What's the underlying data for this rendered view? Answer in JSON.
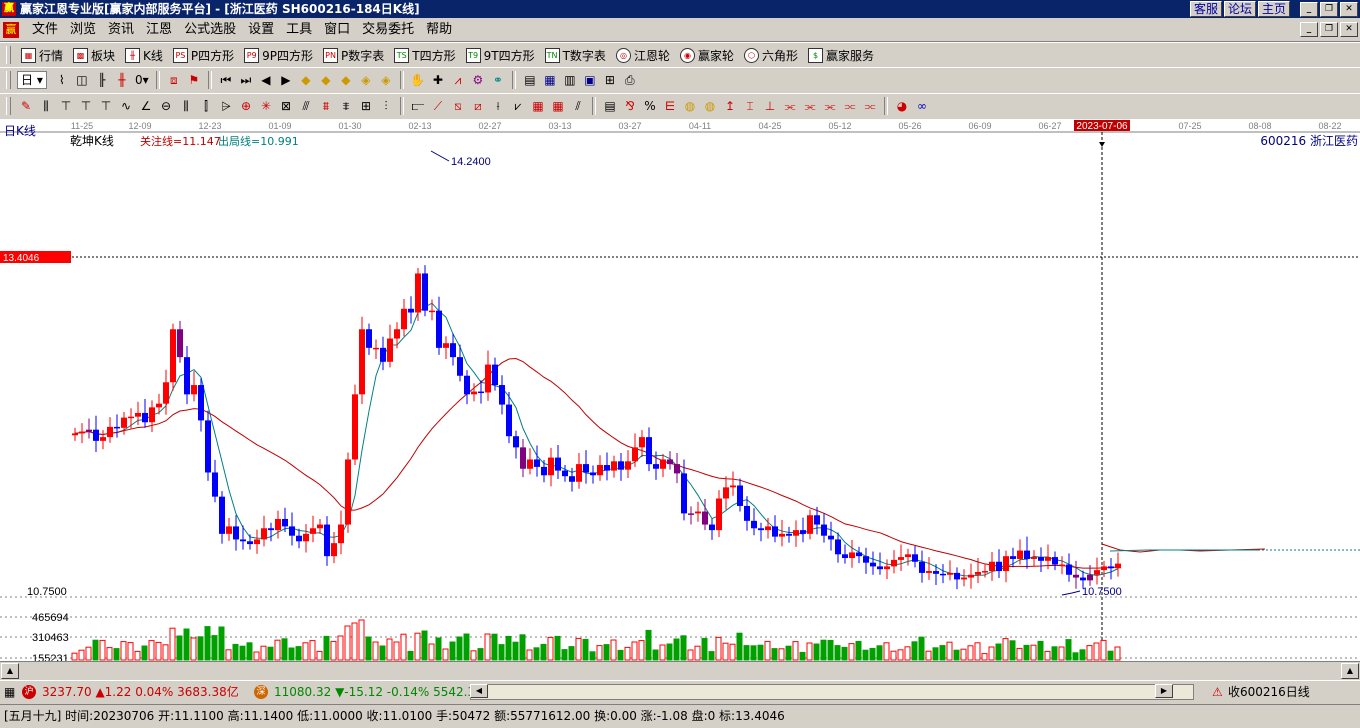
{
  "window": {
    "title": "赢家江恩专业版[赢家内部服务平台] - [浙江医药  SH600216-184日K线]",
    "links": [
      "客服",
      "论坛",
      "主页"
    ]
  },
  "menu": [
    "文件",
    "浏览",
    "资讯",
    "江恩",
    "公式选股",
    "设置",
    "工具",
    "窗口",
    "交易委托",
    "帮助"
  ],
  "toolbar1": [
    "行情",
    "板块",
    "K线",
    "P四方形",
    "9P四方形",
    "P数字表",
    "T四方形",
    "9T四方形",
    "T数字表",
    "江恩轮",
    "赢家轮",
    "六角形",
    "赢家服务"
  ],
  "toolbar2": {
    "period": "日"
  },
  "chart": {
    "period_label": "日K线",
    "indicator_name": "乾坤K线",
    "watch_line": "关注线=11.147",
    "exit_line": "出局线=10.991",
    "stock_label": "600216  浙江医药",
    "cursor_date": "2023-07-06",
    "cursor_price_label": "13.4046",
    "high_label": "14.2400",
    "low_label": "10.7500",
    "axis_low": "10.7500",
    "vol_ticks": [
      "465694",
      "310463",
      "155231"
    ],
    "x_ticks": [
      {
        "label": "11-25",
        "x": 82
      },
      {
        "label": "12-09",
        "x": 140
      },
      {
        "label": "12-23",
        "x": 210
      },
      {
        "label": "01-09",
        "x": 280
      },
      {
        "label": "01-30",
        "x": 350
      },
      {
        "label": "02-13",
        "x": 420
      },
      {
        "label": "02-27",
        "x": 490
      },
      {
        "label": "03-13",
        "x": 560
      },
      {
        "label": "03-27",
        "x": 630
      },
      {
        "label": "04-11",
        "x": 700
      },
      {
        "label": "04-25",
        "x": 770
      },
      {
        "label": "05-12",
        "x": 840
      },
      {
        "label": "05-26",
        "x": 910
      },
      {
        "label": "06-09",
        "x": 980
      },
      {
        "label": "06-27",
        "x": 1050
      },
      {
        "label": "07-25",
        "x": 1190
      },
      {
        "label": "08-08",
        "x": 1260
      },
      {
        "label": "08-22",
        "x": 1330
      }
    ],
    "colors": {
      "up": "#ff0000",
      "down": "#0000ff",
      "special": "#800080",
      "ma_short": "#008080",
      "ma_long": "#c00000"
    }
  },
  "chart_data": {
    "type": "candlestick",
    "closes": [
      12.38,
      12.4,
      12.42,
      12.3,
      12.34,
      12.45,
      12.44,
      12.55,
      12.56,
      12.6,
      12.5,
      12.66,
      12.7,
      12.93,
      13.5,
      13.2,
      12.8,
      12.9,
      12.52,
      11.96,
      11.7,
      11.3,
      11.38,
      11.24,
      11.22,
      11.19,
      11.24,
      11.36,
      11.34,
      11.46,
      11.38,
      11.28,
      11.22,
      11.3,
      11.36,
      11.4,
      11.06,
      11.2,
      11.4,
      12.1,
      12.8,
      13.5,
      13.3,
      13.3,
      13.15,
      13.4,
      13.5,
      13.72,
      13.68,
      14.1,
      13.7,
      13.7,
      13.3,
      13.35,
      13.2,
      13.0,
      12.8,
      12.83,
      12.82,
      13.12,
      12.9,
      12.69,
      12.35,
      12.23,
      12.0,
      12.1,
      12.02,
      11.93,
      12.12,
      11.98,
      11.92,
      11.86,
      12.05,
      11.96,
      11.93,
      12.04,
      11.98,
      12.08,
      11.99,
      12.08,
      12.23,
      12.34,
      12.05,
      12.0,
      12.1,
      12.05,
      11.95,
      11.52,
      11.52,
      11.54,
      11.4,
      11.34,
      11.68,
      11.8,
      11.82,
      11.6,
      11.44,
      11.36,
      11.34,
      11.38,
      11.27,
      11.3,
      11.28,
      11.34,
      11.3,
      11.5,
      11.4,
      11.28,
      11.24,
      11.08,
      11.04,
      11.1,
      11.06,
      10.99,
      10.95,
      10.92,
      10.95,
      11.02,
      11.05,
      11.08,
      11.0,
      10.88,
      10.9,
      10.87,
      10.86,
      10.88,
      10.81,
      10.83,
      10.86,
      10.89,
      10.9,
      11.0,
      10.9,
      11.06,
      11.03,
      11.12,
      11.03,
      11.05,
      11.01,
      11.05,
      10.97,
      10.97,
      10.86,
      10.83,
      10.8,
      10.86,
      10.91,
      10.95,
      10.93,
      10.98
    ],
    "period": "日K线",
    "high": 14.24,
    "low": 10.75
  }
}
